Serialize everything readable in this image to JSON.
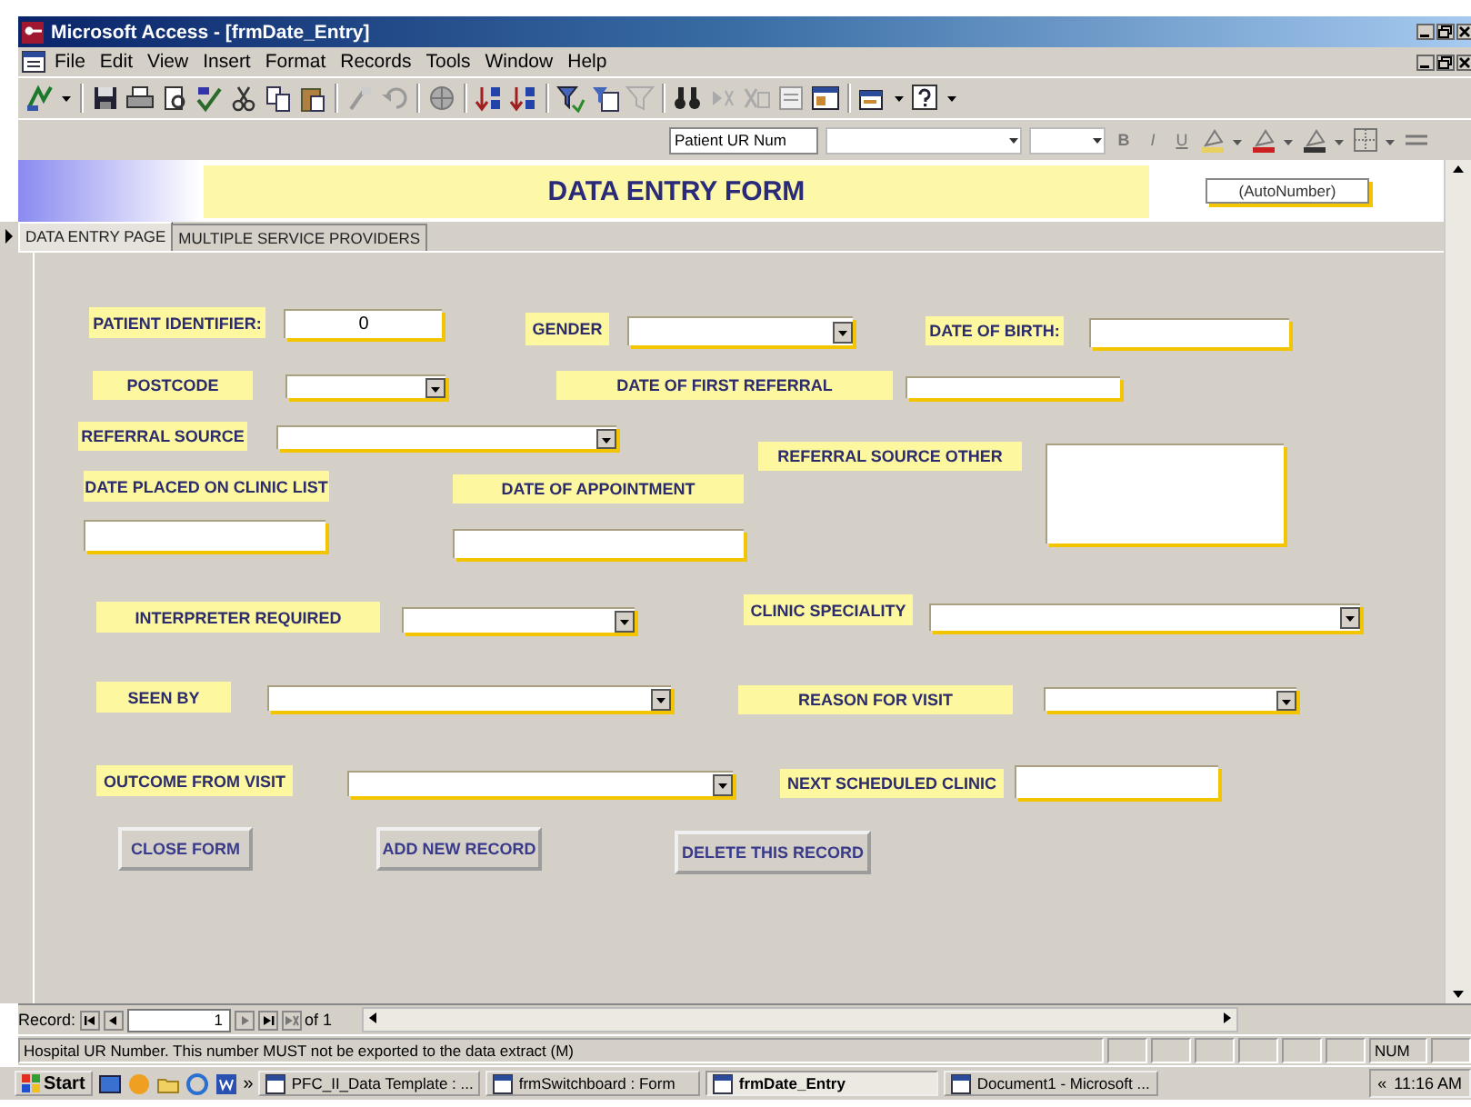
{
  "window": {
    "title": "Microsoft Access - [frmDate_Entry]"
  },
  "menu": [
    "File",
    "Edit",
    "View",
    "Insert",
    "Format",
    "Records",
    "Tools",
    "Window",
    "Help"
  ],
  "format_bar": {
    "object_combo": "Patient UR Num",
    "buttons": [
      "B",
      "I",
      "U"
    ]
  },
  "form_header": {
    "title": "DATA ENTRY FORM",
    "id_field": "(AutoNumber)"
  },
  "tabs": [
    {
      "label": "DATA ENTRY PAGE",
      "selected": true
    },
    {
      "label": "MULTIPLE SERVICE PROVIDERS",
      "selected": false
    }
  ],
  "controls": [
    {
      "kind": "label",
      "text": "PATIENT IDENTIFIER:"
    },
    {
      "kind": "text",
      "value": "0"
    },
    {
      "kind": "label",
      "text": "GENDER"
    },
    {
      "kind": "combo"
    },
    {
      "kind": "label",
      "text": "DATE OF BIRTH:"
    },
    {
      "kind": "text"
    },
    {
      "kind": "label",
      "text": "POSTCODE"
    },
    {
      "kind": "combo"
    },
    {
      "kind": "label",
      "text": "DATE OF FIRST REFERRAL"
    },
    {
      "kind": "text"
    },
    {
      "kind": "label",
      "text": "REFERRAL SOURCE"
    },
    {
      "kind": "combo"
    },
    {
      "kind": "label",
      "text": "DATE PLACED ON CLINIC LIST"
    },
    {
      "kind": "text"
    },
    {
      "kind": "label",
      "text": "DATE OF APPOINTMENT"
    },
    {
      "kind": "text"
    },
    {
      "kind": "label",
      "text": "REFERRAL SOURCE OTHER"
    },
    {
      "kind": "memo"
    },
    {
      "kind": "label",
      "text": "INTERPRETER REQUIRED"
    },
    {
      "kind": "combo"
    },
    {
      "kind": "label",
      "text": "CLINIC SPECIALITY"
    },
    {
      "kind": "combo"
    },
    {
      "kind": "label",
      "text": "SEEN BY"
    },
    {
      "kind": "combo"
    },
    {
      "kind": "label",
      "text": "REASON FOR VISIT"
    },
    {
      "kind": "combo"
    },
    {
      "kind": "label",
      "text": "OUTCOME FROM VISIT"
    },
    {
      "kind": "combo"
    },
    {
      "kind": "label",
      "text": "NEXT SCHEDULED CLINIC"
    },
    {
      "kind": "text"
    },
    {
      "kind": "button",
      "text": "CLOSE FORM"
    },
    {
      "kind": "button",
      "text": "ADD NEW RECORD"
    },
    {
      "kind": "button",
      "text": "DELETE THIS RECORD"
    }
  ],
  "record_nav": {
    "label": "Record:",
    "current": "1",
    "total": "of 1"
  },
  "status_bar": {
    "message": "Hospital UR Number. This number MUST not be exported to the data extract (M)",
    "indicator": "NUM"
  },
  "taskbar": {
    "start": "Start",
    "overflow": "»",
    "tasks": [
      {
        "label": "PFC_II_Data Template : ...",
        "selected": false
      },
      {
        "label": "frmSwitchboard : Form",
        "selected": false
      },
      {
        "label": "frmDate_Entry",
        "selected": true
      },
      {
        "label": "Document1 - Microsoft ...",
        "selected": false
      }
    ],
    "tray_toggle": "«",
    "clock": "11:16 AM"
  }
}
